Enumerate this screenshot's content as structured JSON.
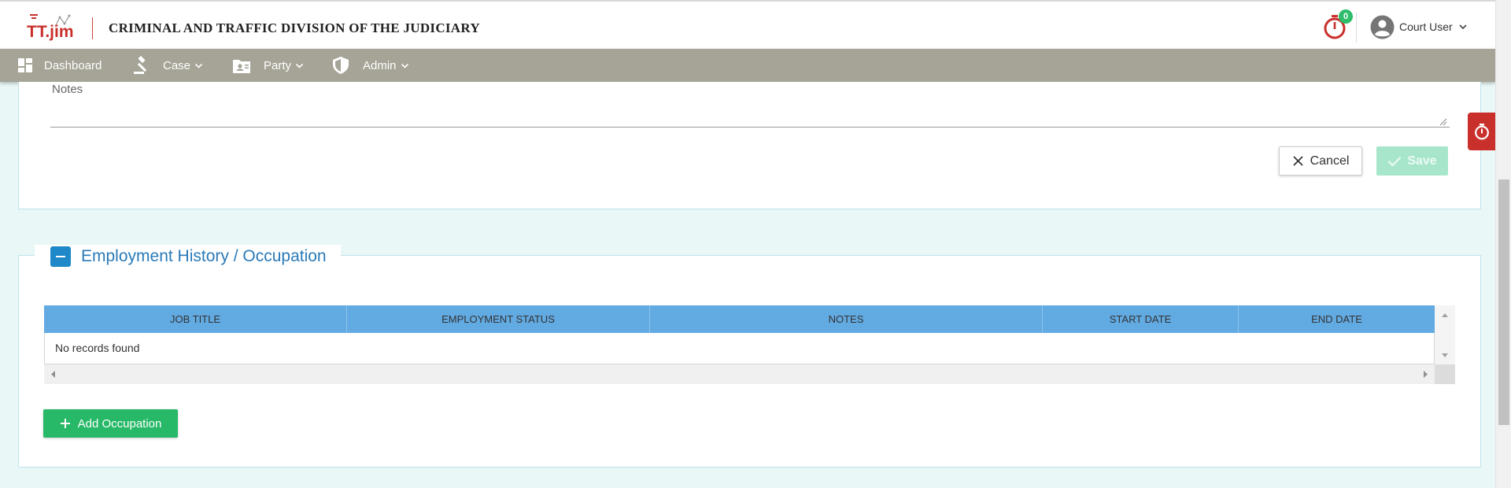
{
  "header": {
    "logo_text": "TT.jim",
    "title": "CRIMINAL AND TRAFFIC DIVISION OF THE JUDICIARY",
    "timer_count": "0",
    "user_name": "Court User"
  },
  "nav": {
    "items": [
      {
        "label": "Dashboard",
        "icon": "dashboard-icon"
      },
      {
        "label": "Case",
        "icon": "gavel-icon"
      },
      {
        "label": "Party",
        "icon": "contact-card-icon"
      },
      {
        "label": "Admin",
        "icon": "shield-icon"
      }
    ]
  },
  "notes_form": {
    "notes_placeholder": "Notes",
    "cancel_label": "Cancel",
    "save_label": "Save"
  },
  "employment": {
    "section_title": "Employment History / Occupation",
    "columns": [
      "JOB TITLE",
      "EMPLOYMENT STATUS",
      "NOTES",
      "START DATE",
      "END DATE"
    ],
    "empty_message": "No records found",
    "add_label": "Add Occupation"
  },
  "colors": {
    "header_bar": "#a5a496",
    "table_header": "#62aae2",
    "add_button": "#27b967",
    "save_button_disabled": "#a8e6cc",
    "timer_red": "#c9302c",
    "badge_green": "#2ebd6b",
    "section_title": "#2a7ab8"
  }
}
